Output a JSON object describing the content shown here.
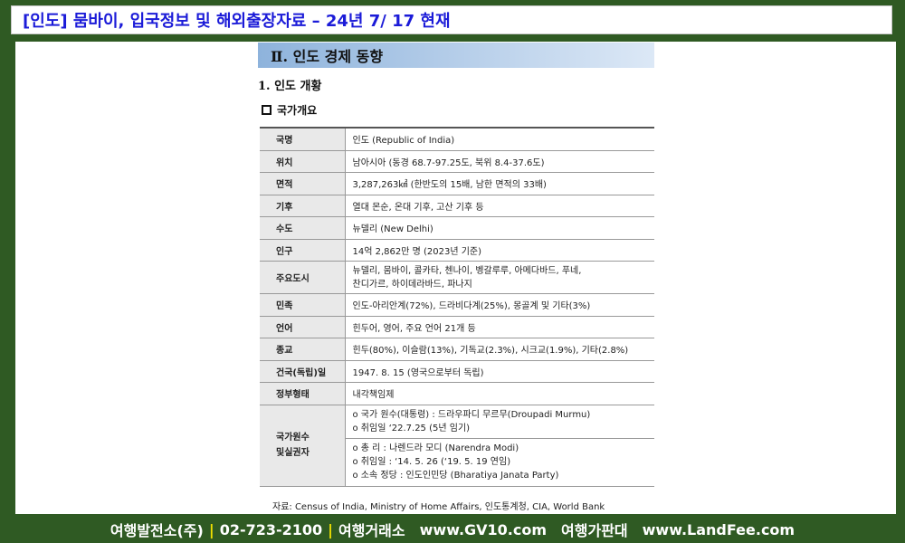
{
  "title_bar": {
    "text": "[인도] 뭄바이,  입국정보 및 해외출장자료 – 24년 7/ 17 현재"
  },
  "section": {
    "header": "Ⅱ. 인도 경제 동향",
    "subtitle": "1. 인도 개황",
    "box_label": "국가개요"
  },
  "table": {
    "rows": [
      {
        "key": "국명",
        "value": "인도 (Republic of India)"
      },
      {
        "key": "위치",
        "value": "남아시아 (동경 68.7-97.25도, 북위 8.4-37.6도)"
      },
      {
        "key": "면적",
        "value": "3,287,263㎢ (한반도의 15배, 남한 면적의 33배)"
      },
      {
        "key": "기후",
        "value": "열대 몬순, 온대 기후, 고산 기후 등"
      },
      {
        "key": "수도",
        "value": "뉴델리 (New Delhi)"
      },
      {
        "key": "인구",
        "value": "14억 2,862만 명 (2023년 기준)"
      },
      {
        "key": "주요도시",
        "value_lines": [
          "뉴델리, 뭄바이, 콜카타, 첸나이, 벵갈루루, 아메다바드, 푸네,",
          "찬디가르, 하이데라바드, 파나지"
        ]
      },
      {
        "key": "민족",
        "value": "인도-아리안계(72%), 드라비다계(25%), 몽골계 및 기타(3%)"
      },
      {
        "key": "언어",
        "value": "힌두어, 영어, 주요 언어 21개 등"
      },
      {
        "key": "종교",
        "value": "힌두(80%), 이슬람(13%), 기독교(2.3%), 시크교(1.9%), 기타(2.8%)"
      },
      {
        "key": "건국(독립)일",
        "value": "1947. 8. 15 (영국으로부터 독립)"
      },
      {
        "key": "정부형태",
        "value": "내각책임제"
      }
    ],
    "head_of_state": {
      "key_line1": "국가원수",
      "key_line2": "및실권자",
      "block1": [
        "o 국가 원수(대통령) : 드라우파디 무르무(Droupadi Murmu)",
        "o 취임일 ‘22.7.25 (5년 임기)"
      ],
      "block2": [
        "o 총    리 : 나렌드라 모디 (Narendra Modi)",
        "o 취임일 : ‘14. 5. 26 (‘19. 5. 19 연임)",
        "o 소속 정당 : 인도인민당 (Bharatiya Janata Party)"
      ]
    }
  },
  "source": "자료: Census of India, Ministry of Home Affairs, 인도통계청, CIA, World Bank",
  "footer": {
    "company": "여행발전소(주)",
    "phone": "02-723-2100",
    "text1": "여행거래소",
    "url1": "www.GV10.com",
    "text2": "여행가판대",
    "url2": "www.LandFee.com",
    "separator": "|"
  }
}
